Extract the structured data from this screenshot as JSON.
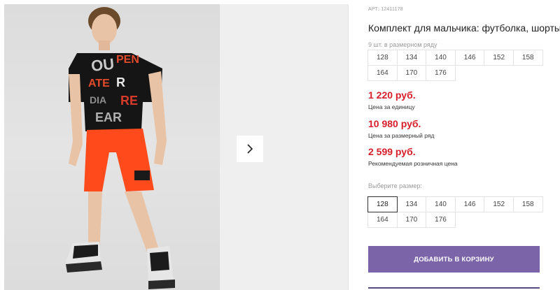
{
  "gallery": {
    "photo_alt": "Мальчик в комплекте: футболка и шорты",
    "next_icon": "chevron-right-icon"
  },
  "product": {
    "article": "АРТ: 12411178",
    "title": "Комплект для мальчика: футболка, шорты",
    "row_count": "9 шт. в размерном ряду",
    "size_row": [
      "128",
      "134",
      "140",
      "146",
      "152",
      "158",
      "164",
      "170",
      "176"
    ],
    "prices": [
      {
        "value": "1 220 руб.",
        "label": "Цена за единицу"
      },
      {
        "value": "10 980 руб.",
        "label": "Цена за размерный ряд"
      },
      {
        "value": "2 599 руб.",
        "label": "Рекомендуемая розничная цена"
      }
    ],
    "choose_size_label": "Выберите размер:",
    "size_options": [
      "128",
      "134",
      "140",
      "146",
      "152",
      "158",
      "164",
      "170",
      "176"
    ],
    "selected_size": "128",
    "add_to_cart": "ДОБАВИТЬ В КОРЗИНУ"
  },
  "colors": {
    "price": "#d81e2a",
    "button": "#7b65a8"
  }
}
